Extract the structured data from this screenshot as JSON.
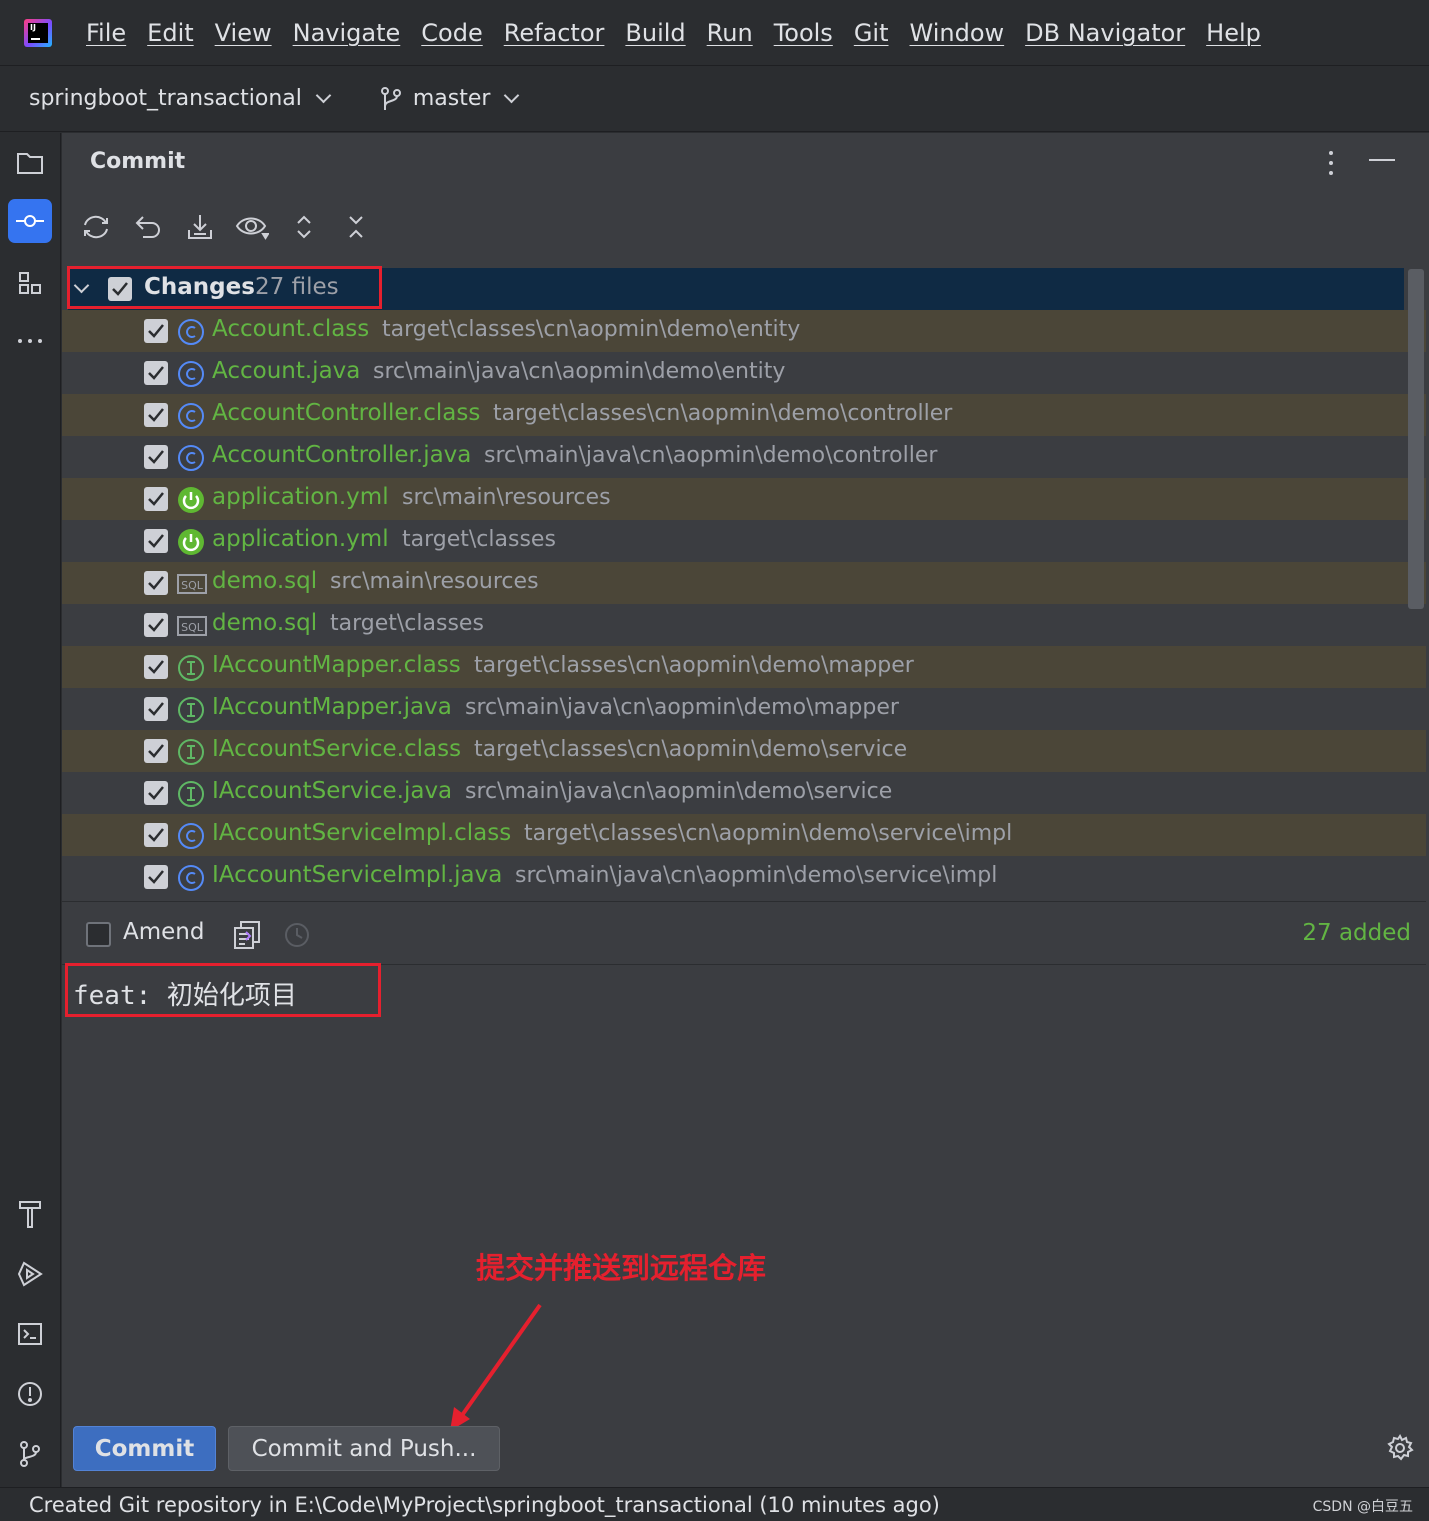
{
  "menu": [
    "File",
    "Edit",
    "View",
    "Navigate",
    "Code",
    "Refactor",
    "Build",
    "Run",
    "Tools",
    "Git",
    "Window",
    "DB Navigator",
    "Help"
  ],
  "app_logo_text": "IJ",
  "project": {
    "name": "springboot_transactional",
    "branch": "master"
  },
  "panel": {
    "title": "Commit"
  },
  "changes": {
    "label": "Changes",
    "count": "27 files"
  },
  "files": [
    {
      "name": "Account.class",
      "path": "target\\classes\\cn\\aopmin\\demo\\entity",
      "icon": "class-icon"
    },
    {
      "name": "Account.java",
      "path": "src\\main\\java\\cn\\aopmin\\demo\\entity",
      "icon": "class-icon"
    },
    {
      "name": "AccountController.class",
      "path": "target\\classes\\cn\\aopmin\\demo\\controller",
      "icon": "class-icon"
    },
    {
      "name": "AccountController.java",
      "path": "src\\main\\java\\cn\\aopmin\\demo\\controller",
      "icon": "class-icon"
    },
    {
      "name": "application.yml",
      "path": "src\\main\\resources",
      "icon": "spring-icon"
    },
    {
      "name": "application.yml",
      "path": "target\\classes",
      "icon": "spring-icon"
    },
    {
      "name": "demo.sql",
      "path": "src\\main\\resources",
      "icon": "sql-icon"
    },
    {
      "name": "demo.sql",
      "path": "target\\classes",
      "icon": "sql-icon"
    },
    {
      "name": "IAccountMapper.class",
      "path": "target\\classes\\cn\\aopmin\\demo\\mapper",
      "icon": "interface-icon"
    },
    {
      "name": "IAccountMapper.java",
      "path": "src\\main\\java\\cn\\aopmin\\demo\\mapper",
      "icon": "interface-icon"
    },
    {
      "name": "IAccountService.class",
      "path": "target\\classes\\cn\\aopmin\\demo\\service",
      "icon": "interface-icon"
    },
    {
      "name": "IAccountService.java",
      "path": "src\\main\\java\\cn\\aopmin\\demo\\service",
      "icon": "interface-icon"
    },
    {
      "name": "IAccountServiceImpl.class",
      "path": "target\\classes\\cn\\aopmin\\demo\\service\\impl",
      "icon": "class-icon"
    },
    {
      "name": "IAccountServiceImpl.java",
      "path": "src\\main\\java\\cn\\aopmin\\demo\\service\\impl",
      "icon": "class-icon"
    }
  ],
  "amend": {
    "label": "Amend",
    "status": "27 added"
  },
  "commit_message": "feat: 初始化项目",
  "annotation": "提交并推送到远程仓库",
  "buttons": {
    "commit": "Commit",
    "commit_push": "Commit and Push..."
  },
  "status_bar": "Created Git repository in E:\\Code\\MyProject\\springboot_transactional (10 minutes ago)",
  "watermark": "CSDN @白豆五",
  "colors": {
    "accent": "#3574f0",
    "added_green": "#62b543",
    "annotation_red": "#e5202e",
    "alt_row": "#4b4638",
    "selected_row": "#0f2a44"
  }
}
